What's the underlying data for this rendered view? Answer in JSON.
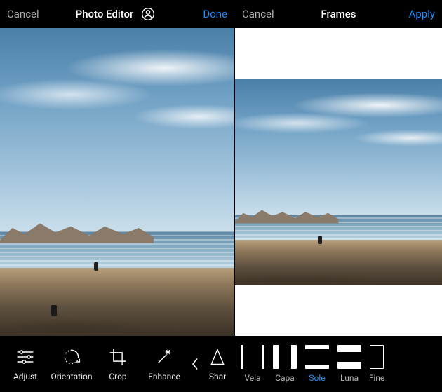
{
  "left": {
    "header": {
      "cancel": "Cancel",
      "title": "Photo Editor",
      "action": "Done"
    },
    "toolbar": {
      "adjust": "Adjust",
      "orientation": "Orientation",
      "crop": "Crop",
      "enhance": "Enhance",
      "sharpen": "Shar"
    }
  },
  "right": {
    "header": {
      "cancel": "Cancel",
      "title": "Frames",
      "action": "Apply"
    },
    "frames": {
      "vela": "Vela",
      "capa": "Capa",
      "sole": "Sole",
      "luna": "Luna",
      "fine": "Fine",
      "selected": "sole"
    }
  }
}
